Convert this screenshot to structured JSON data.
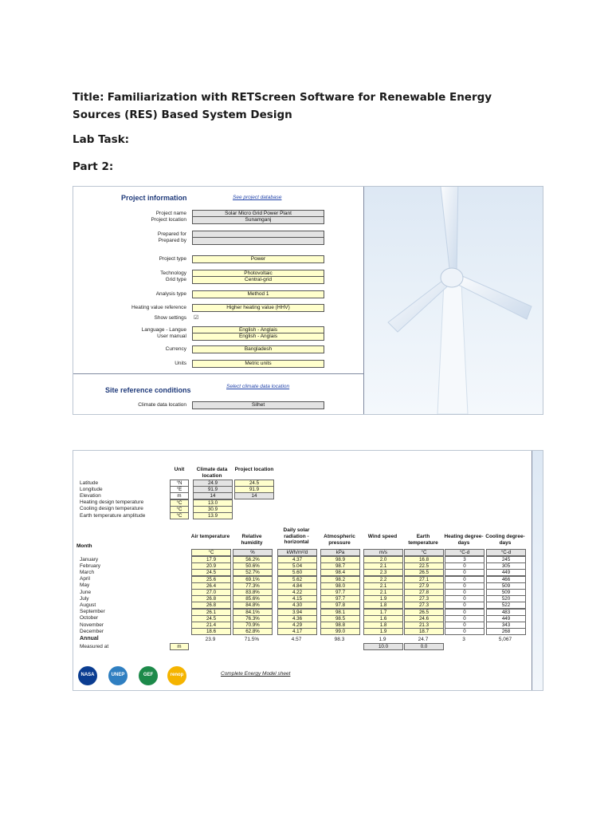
{
  "doc": {
    "title_prefix": "Title:",
    "title_text": "Familiarization with RETScreen Software for Renewable Energy Sources (RES) Based System Design",
    "lab_task": "Lab Task:",
    "part": "Part 2:"
  },
  "project_info": {
    "heading": "Project information",
    "see_link": "See project database",
    "fields": [
      {
        "label": "Project name",
        "value": "Solar Micro Grid Power Plant"
      },
      {
        "label": "Project location",
        "value": "Sunamganj"
      },
      {
        "label": "Prepared for",
        "value": ""
      },
      {
        "label": "Prepared by",
        "value": ""
      },
      {
        "label": "Project type",
        "value": "Power"
      },
      {
        "label": "Technology",
        "value": "Photovoltaic"
      },
      {
        "label": "Grid type",
        "value": "Central-grid"
      },
      {
        "label": "Analysis type",
        "value": "Method 1"
      },
      {
        "label": "Heating value reference",
        "value": "Higher heating value (HHV)"
      },
      {
        "label": "Show settings",
        "value": "☑"
      },
      {
        "label": "Language - Langue",
        "value": "English - Anglais"
      },
      {
        "label": "User manual",
        "value": "English - Anglais"
      },
      {
        "label": "Currency",
        "value": "Bangladesh"
      },
      {
        "label": "Units",
        "value": "Metric units"
      }
    ],
    "site_heading": "Site reference conditions",
    "select_link": "Select climate data location",
    "climate_label": "Climate data location",
    "climate_value": "Silhet"
  },
  "climate": {
    "col_unit": "Unit",
    "col_climate": "Climate data location",
    "col_project": "Project location",
    "site_rows": [
      {
        "label": "Latitude",
        "unit": "°N",
        "climate": "24.9",
        "project": "24.5"
      },
      {
        "label": "Longitude",
        "unit": "°E",
        "climate": "91.9",
        "project": "91.9"
      },
      {
        "label": "Elevation",
        "unit": "m",
        "climate": "14",
        "project": "14"
      },
      {
        "label": "Heating design temperature",
        "unit": "°C",
        "climate": "13.0",
        "project": ""
      },
      {
        "label": "Cooling design temperature",
        "unit": "°C",
        "climate": "30.9",
        "project": ""
      },
      {
        "label": "Earth temperature amplitude",
        "unit": "°C",
        "climate": "13.9",
        "project": ""
      }
    ],
    "month_header": "Month",
    "headers": [
      "Air temperature",
      "Relative humidity",
      "Daily solar radiation - horizontal",
      "Atmospheric pressure",
      "Wind speed",
      "Earth temperature",
      "Heating degree-days",
      "Cooling degree-days"
    ],
    "units": [
      "°C",
      "%",
      "kWh/m²/d",
      "kPa",
      "m/s",
      "°C",
      "°C-d",
      "°C-d"
    ],
    "months": [
      {
        "m": "January",
        "v": [
          "17.9",
          "56.2%",
          "4.37",
          "98.9",
          "2.0",
          "16.8",
          "3",
          "245"
        ]
      },
      {
        "m": "February",
        "v": [
          "20.9",
          "50.6%",
          "5.04",
          "98.7",
          "2.1",
          "22.5",
          "0",
          "305"
        ]
      },
      {
        "m": "March",
        "v": [
          "24.5",
          "52.7%",
          "5.60",
          "98.4",
          "2.3",
          "26.5",
          "0",
          "449"
        ]
      },
      {
        "m": "April",
        "v": [
          "25.6",
          "69.1%",
          "5.62",
          "98.2",
          "2.2",
          "27.1",
          "0",
          "466"
        ]
      },
      {
        "m": "May",
        "v": [
          "26.4",
          "77.3%",
          "4.84",
          "98.0",
          "2.1",
          "27.9",
          "0",
          "509"
        ]
      },
      {
        "m": "June",
        "v": [
          "27.0",
          "83.8%",
          "4.22",
          "97.7",
          "2.1",
          "27.8",
          "0",
          "509"
        ]
      },
      {
        "m": "July",
        "v": [
          "26.8",
          "85.6%",
          "4.15",
          "97.7",
          "1.9",
          "27.3",
          "0",
          "520"
        ]
      },
      {
        "m": "August",
        "v": [
          "26.8",
          "84.8%",
          "4.30",
          "97.8",
          "1.8",
          "27.3",
          "0",
          "522"
        ]
      },
      {
        "m": "September",
        "v": [
          "26.1",
          "84.1%",
          "3.94",
          "98.1",
          "1.7",
          "26.5",
          "0",
          "483"
        ]
      },
      {
        "m": "October",
        "v": [
          "24.5",
          "76.3%",
          "4.36",
          "98.5",
          "1.6",
          "24.6",
          "0",
          "449"
        ]
      },
      {
        "m": "November",
        "v": [
          "21.4",
          "70.9%",
          "4.29",
          "98.8",
          "1.8",
          "21.3",
          "0",
          "343"
        ]
      },
      {
        "m": "December",
        "v": [
          "18.6",
          "62.8%",
          "4.17",
          "99.0",
          "1.9",
          "18.7",
          "0",
          "268"
        ]
      }
    ],
    "annual_label": "Annual",
    "annual": [
      "23.9",
      "71.5%",
      "4.57",
      "98.3",
      "1.9",
      "24.7",
      "3",
      "5,067"
    ],
    "measured_label": "Measured at",
    "measured_unit": "m",
    "measured_wind": "10.0",
    "measured_earth": "0.0",
    "complete_link": "Complete Energy Model sheet",
    "logos": [
      {
        "text": "NASA",
        "color": "#0b3d91",
        "icon": "nasa-logo"
      },
      {
        "text": "UNEP",
        "color": "#2f7fc1",
        "icon": "unep-logo"
      },
      {
        "text": "GEF",
        "color": "#1d8a4a",
        "icon": "gef-logo"
      },
      {
        "text": "renop",
        "color": "#f5b400",
        "icon": "renop-logo"
      }
    ]
  }
}
